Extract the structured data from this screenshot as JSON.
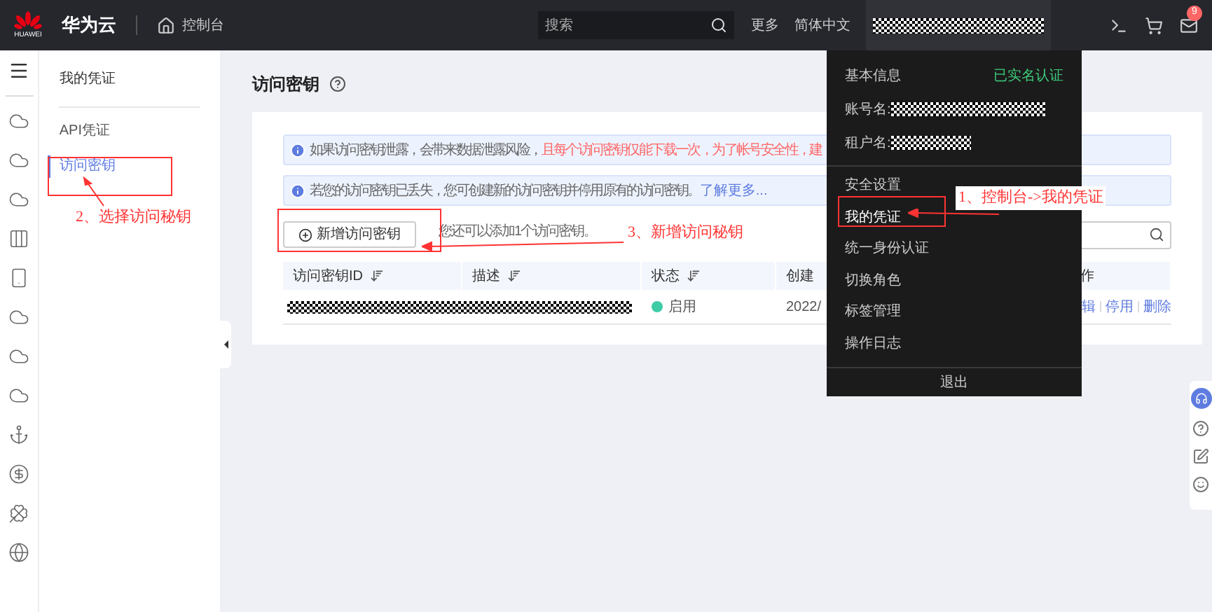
{
  "topbar": {
    "brand_logo": "HUAWEI",
    "brand": "华为云",
    "console": "控制台",
    "search": {
      "placeholder": "搜索"
    },
    "links": [
      "更多",
      "简体中文"
    ],
    "mail_badge": "9"
  },
  "sidebar": {
    "title": "我的凭证",
    "items": [
      {
        "label": "API凭证",
        "selected": false
      },
      {
        "label": "访问密钥",
        "selected": true
      }
    ]
  },
  "page": {
    "title": "访问密钥",
    "notices": [
      {
        "text": "如果访问密钥泄露，会带来数据泄露风险，",
        "highlight": "且每个访问密钥仅能下载一次，为了帐号安全性，建"
      },
      {
        "text": "若您的访问密钥已丢失，您可创建新的访问密钥并停用原有的访问密钥。",
        "link": "了解更多..."
      }
    ],
    "add_button": "新增访问密钥",
    "quota_note": "您还可以添加1个访问密钥。",
    "table": {
      "columns": [
        "访问密钥ID",
        "描述",
        "状态",
        "创建",
        "作"
      ],
      "rows": [
        {
          "status": "启用",
          "enabled": true,
          "created": "2022/",
          "actions": [
            "辑",
            "停用",
            "删除"
          ]
        }
      ]
    }
  },
  "user_menu": {
    "info_label": "基本信息",
    "verified": "已实名认证",
    "account_label": "账号名:",
    "tenant_label": "租户名:",
    "items": [
      {
        "label": "安全设置",
        "selected": false
      },
      {
        "label": "我的凭证",
        "selected": true
      },
      {
        "label": "统一身份认证",
        "selected": false
      },
      {
        "label": "切换角色",
        "selected": false
      },
      {
        "label": "标签管理",
        "selected": false
      },
      {
        "label": "操作日志",
        "selected": false
      }
    ],
    "logout": "退出"
  },
  "annotations": [
    {
      "text": "1、控制台->我的凭证"
    },
    {
      "text": "2、选择访问秘钥"
    },
    {
      "text": "3、新增访问秘钥"
    }
  ]
}
